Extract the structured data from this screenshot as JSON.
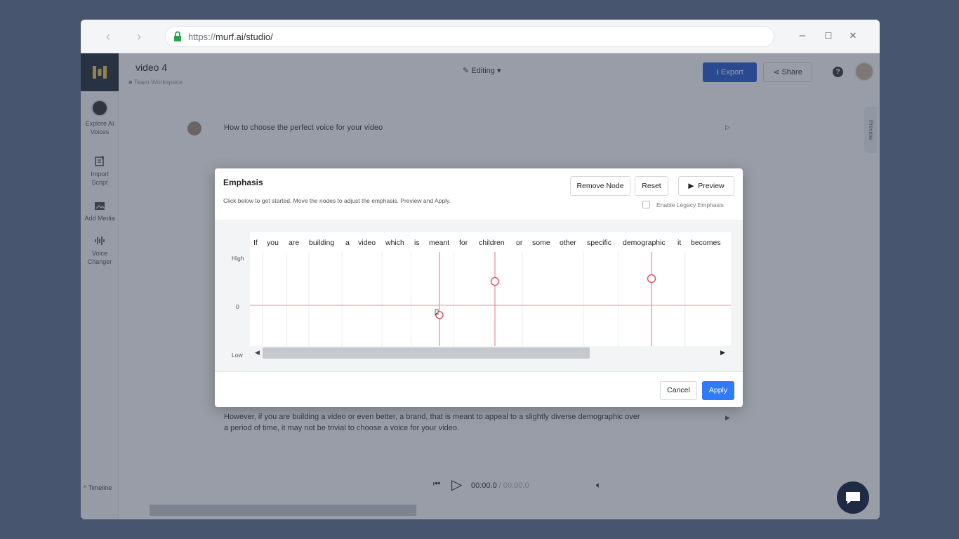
{
  "browser": {
    "url_proto": "https://",
    "url_rest": "murf.ai/studio/",
    "back_icon": "chevron-left-icon",
    "forward_icon": "chevron-right-icon",
    "minimize": "–",
    "maximize": "☐",
    "close": "✕"
  },
  "sidebar": {
    "items": [
      {
        "label1": "Explore AI",
        "label2": "Voices"
      },
      {
        "label1": "Import",
        "label2": "Script"
      },
      {
        "label1": "Add Media",
        "label2": ""
      },
      {
        "label1": "Voice",
        "label2": "Changer"
      }
    ]
  },
  "header": {
    "project_title": "video 4",
    "project_sub": "Team Workspace",
    "status": "Editing",
    "export_label": "Export",
    "share_label": "Share",
    "help": "?"
  },
  "content": {
    "block1": "How to choose the perfect voice for your video",
    "block2_line1": "However, if you are building a video or even better, a brand, that is meant to appeal to a slightly diverse demographic over",
    "block2_line2": "a period of time, it may not be trivial to choose a voice for your video.",
    "preview_tab": "Preview",
    "time_current": "00:00.0",
    "time_sep": " / ",
    "time_total": "00:00.0",
    "timeline_label": "Timeline"
  },
  "modal": {
    "title": "Emphasis",
    "subtitle": "Click below to get started. Move the nodes to adjust the emphasis. Preview and Apply.",
    "remove_node": "Remove Node",
    "reset": "Reset",
    "preview": "Preview",
    "legacy_label": "Enable Legacy Emphasis",
    "y_labels": {
      "high": "High",
      "zero": "0",
      "low": "Low"
    },
    "words": [
      "If",
      "you",
      "are",
      "building",
      "a",
      "video",
      "which",
      "is",
      "meant",
      "for",
      "children",
      "or",
      "some",
      "other",
      "specific",
      "demographic",
      "it",
      "becomes"
    ],
    "cancel": "Cancel",
    "apply": "Apply"
  },
  "colors": {
    "accent_blue": "#2f7cf6",
    "export_blue": "#2357d1",
    "node_red": "#e05566"
  }
}
